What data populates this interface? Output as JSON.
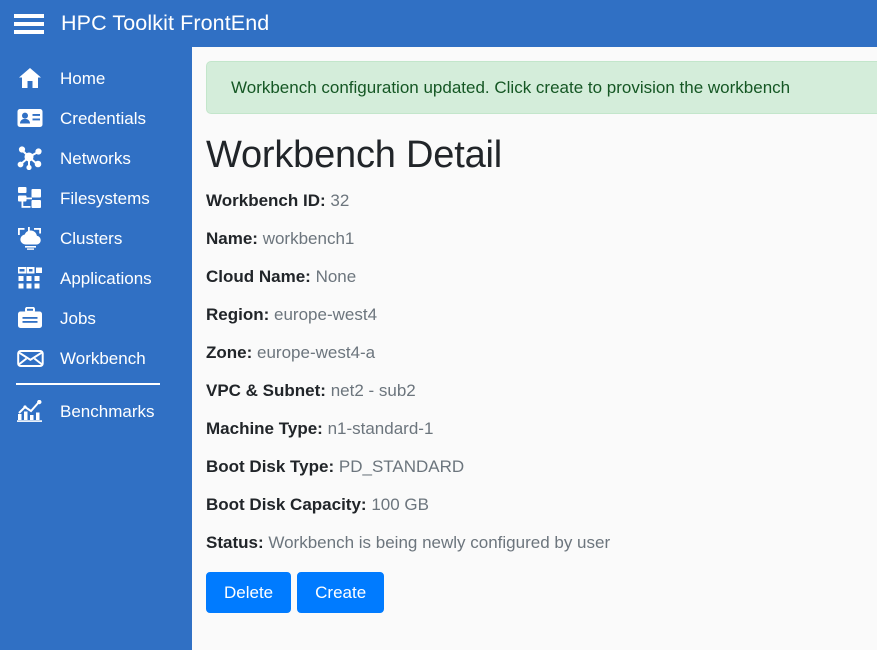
{
  "navbar": {
    "menu_icon": "hamburger-menu-icon",
    "brand_title": "HPC Toolkit FrontEnd",
    "background_color": "#3070c4"
  },
  "sidebar": {
    "background_color": "#3070c4",
    "active_item": "Workbench",
    "items": [
      {
        "label": "Home",
        "icon": "home-icon"
      },
      {
        "label": "Credentials",
        "icon": "id-card-icon"
      },
      {
        "label": "Networks",
        "icon": "network-nodes-icon"
      },
      {
        "label": "Filesystems",
        "icon": "servers-icon"
      },
      {
        "label": "Clusters",
        "icon": "cluster-cloud-icon"
      },
      {
        "label": "Applications",
        "icon": "apps-grid-icon"
      },
      {
        "label": "Jobs",
        "icon": "briefcase-icon"
      },
      {
        "label": "Workbench",
        "icon": "envelope-icon"
      },
      {
        "label": "Benchmarks",
        "icon": "chart-line-icon"
      }
    ],
    "divider_after_index": 7
  },
  "main": {
    "alert": {
      "message": "Workbench configuration updated. Click create to provision the workbench",
      "type": "success",
      "background_color": "#d4edda",
      "text_color": "#155724"
    },
    "page_title": "Workbench Detail",
    "details": [
      {
        "label": "Workbench ID:",
        "value": "32"
      },
      {
        "label": "Name:",
        "value": "workbench1"
      },
      {
        "label": "Cloud Name:",
        "value": "None"
      },
      {
        "label": "Region:",
        "value": "europe-west4"
      },
      {
        "label": "Zone:",
        "value": "europe-west4-a"
      },
      {
        "label": "VPC & Subnet:",
        "value": "net2 - sub2"
      },
      {
        "label": "Machine Type:",
        "value": "n1-standard-1"
      },
      {
        "label": "Boot Disk Type:",
        "value": "PD_STANDARD"
      },
      {
        "label": "Boot Disk Capacity:",
        "value": "100 GB"
      },
      {
        "label": "Status:",
        "value": "Workbench is being newly configured by user"
      }
    ],
    "buttons": [
      {
        "label": "Delete",
        "color": "#007bff"
      },
      {
        "label": "Create",
        "color": "#007bff"
      }
    ]
  }
}
